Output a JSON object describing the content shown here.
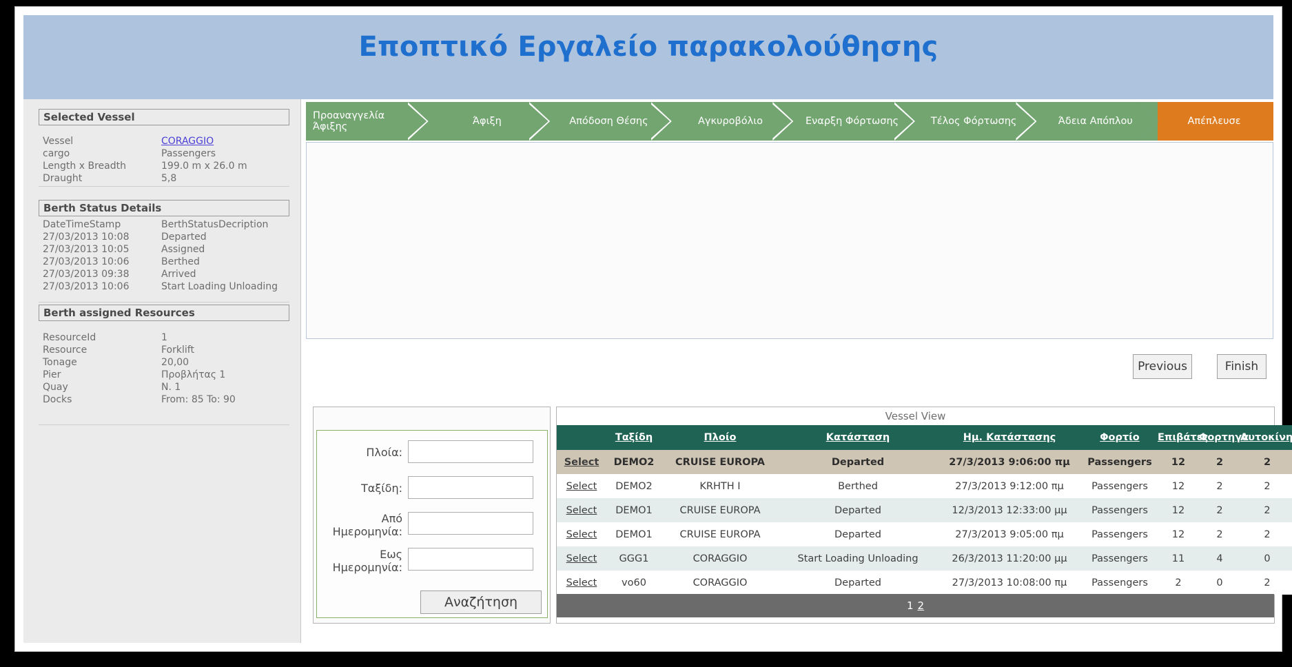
{
  "page_title": "Εποπτικό Εργαλείο παρακολούθησης",
  "colors": {
    "banner": "#aec4de",
    "title_text": "#1f6fce",
    "step_green": "#73a571",
    "step_active_orange": "#dd7b1e",
    "grid_header_green": "#1f6355",
    "row_selected": "#cfc5b4",
    "pager_gray": "#6b6b6b",
    "link_blue": "#4b3fd6"
  },
  "sidebar": {
    "selected_vessel": {
      "heading": "Selected Vessel",
      "rows": [
        {
          "key": "Vessel",
          "value": "CORAGGIO",
          "is_link": true
        },
        {
          "key": "cargo",
          "value": "Passengers"
        },
        {
          "key": "Length x Breadth",
          "value": "199.0 m x 26.0 m"
        },
        {
          "key": "Draught",
          "value": "5,8"
        }
      ]
    },
    "berth_status": {
      "heading": "Berth Status Details",
      "columns": [
        "DateTimeStamp",
        "BerthStatusDecription"
      ],
      "rows": [
        [
          "27/03/2013 10:08",
          "Departed"
        ],
        [
          "27/03/2013 10:05",
          "Assigned"
        ],
        [
          "27/03/2013 10:06",
          "Berthed"
        ],
        [
          "27/03/2013 09:38",
          "Arrived"
        ],
        [
          "27/03/2013 10:06",
          "Start Loading Unloading"
        ]
      ]
    },
    "berth_resources": {
      "heading": "Berth assigned Resources",
      "rows": [
        {
          "key": "ResourceId",
          "value": "1"
        },
        {
          "key": "Resource",
          "value": "Forklift"
        },
        {
          "key": "Tonage",
          "value": "20,00"
        },
        {
          "key": "Pier",
          "value": "Προβλήτας 1"
        },
        {
          "key": "Quay",
          "value": "Ν. 1"
        },
        {
          "key": "Docks",
          "value": "From: 85 To: 90"
        }
      ]
    }
  },
  "wizard": {
    "steps": [
      {
        "label": "Προαναγγελία Άφιξης",
        "active": false
      },
      {
        "label": "Άφιξη",
        "active": false
      },
      {
        "label": "Απόδοση Θέσης",
        "active": false
      },
      {
        "label": "Αγκυροβόλιο",
        "active": false
      },
      {
        "label": "Εναρξη Φόρτωσης",
        "active": false
      },
      {
        "label": "Τέλος Φόρτωσης",
        "active": false
      },
      {
        "label": "Άδεια Απόπλου",
        "active": false
      },
      {
        "label": "Απέπλευσε",
        "active": true
      }
    ],
    "previous_label": "Previous",
    "finish_label": "Finish"
  },
  "search_form": {
    "fields": [
      {
        "label": "Πλοία:",
        "value": "",
        "placeholder": ""
      },
      {
        "label": "Ταξίδη:",
        "value": "",
        "placeholder": ""
      },
      {
        "label": "Από Ημερομηνία:",
        "value": "",
        "placeholder": ""
      },
      {
        "label": "Εως Ημερομηνία:",
        "value": "",
        "placeholder": ""
      }
    ],
    "submit_label": "Αναζήτηση"
  },
  "vessel_view": {
    "caption": "Vessel View",
    "columns": [
      "",
      "Ταξίδη",
      "Πλοίο",
      "Κατάσταση",
      "Ημ. Κατάστασης",
      "Φορτίο",
      "Επιβάτες",
      "Φορτηγα",
      "Αυτοκίνητα"
    ],
    "select_label": "Select",
    "rows": [
      {
        "select": "Select",
        "trip": "DEMO2",
        "vessel": "CRUISE EUROPA",
        "status": "Departed",
        "status_date": "27/3/2013 9:06:00 πμ",
        "cargo": "Passengers",
        "passengers": "12",
        "trucks": "2",
        "cars": "2",
        "selected": true
      },
      {
        "select": "Select",
        "trip": "DEMO2",
        "vessel": "KRHTH I",
        "status": "Berthed",
        "status_date": "27/3/2013 9:12:00 πμ",
        "cargo": "Passengers",
        "passengers": "12",
        "trucks": "2",
        "cars": "2",
        "selected": false
      },
      {
        "select": "Select",
        "trip": "DEMO1",
        "vessel": "CRUISE EUROPA",
        "status": "Departed",
        "status_date": "12/3/2013 12:33:00 μμ",
        "cargo": "Passengers",
        "passengers": "12",
        "trucks": "2",
        "cars": "2",
        "selected": false
      },
      {
        "select": "Select",
        "trip": "DEMO1",
        "vessel": "CRUISE EUROPA",
        "status": "Departed",
        "status_date": "27/3/2013 9:05:00 πμ",
        "cargo": "Passengers",
        "passengers": "12",
        "trucks": "2",
        "cars": "2",
        "selected": false
      },
      {
        "select": "Select",
        "trip": "GGG1",
        "vessel": "CORAGGIO",
        "status": "Start Loading Unloading",
        "status_date": "26/3/2013 11:20:00 μμ",
        "cargo": "Passengers",
        "passengers": "11",
        "trucks": "4",
        "cars": "0",
        "selected": false
      },
      {
        "select": "Select",
        "trip": "vo60",
        "vessel": "CORAGGIO",
        "status": "Departed",
        "status_date": "27/3/2013 10:08:00 πμ",
        "cargo": "Passengers",
        "passengers": "2",
        "trucks": "0",
        "cars": "2",
        "selected": false
      }
    ],
    "pager": {
      "current": "1",
      "pages": [
        "1",
        "2"
      ]
    }
  }
}
